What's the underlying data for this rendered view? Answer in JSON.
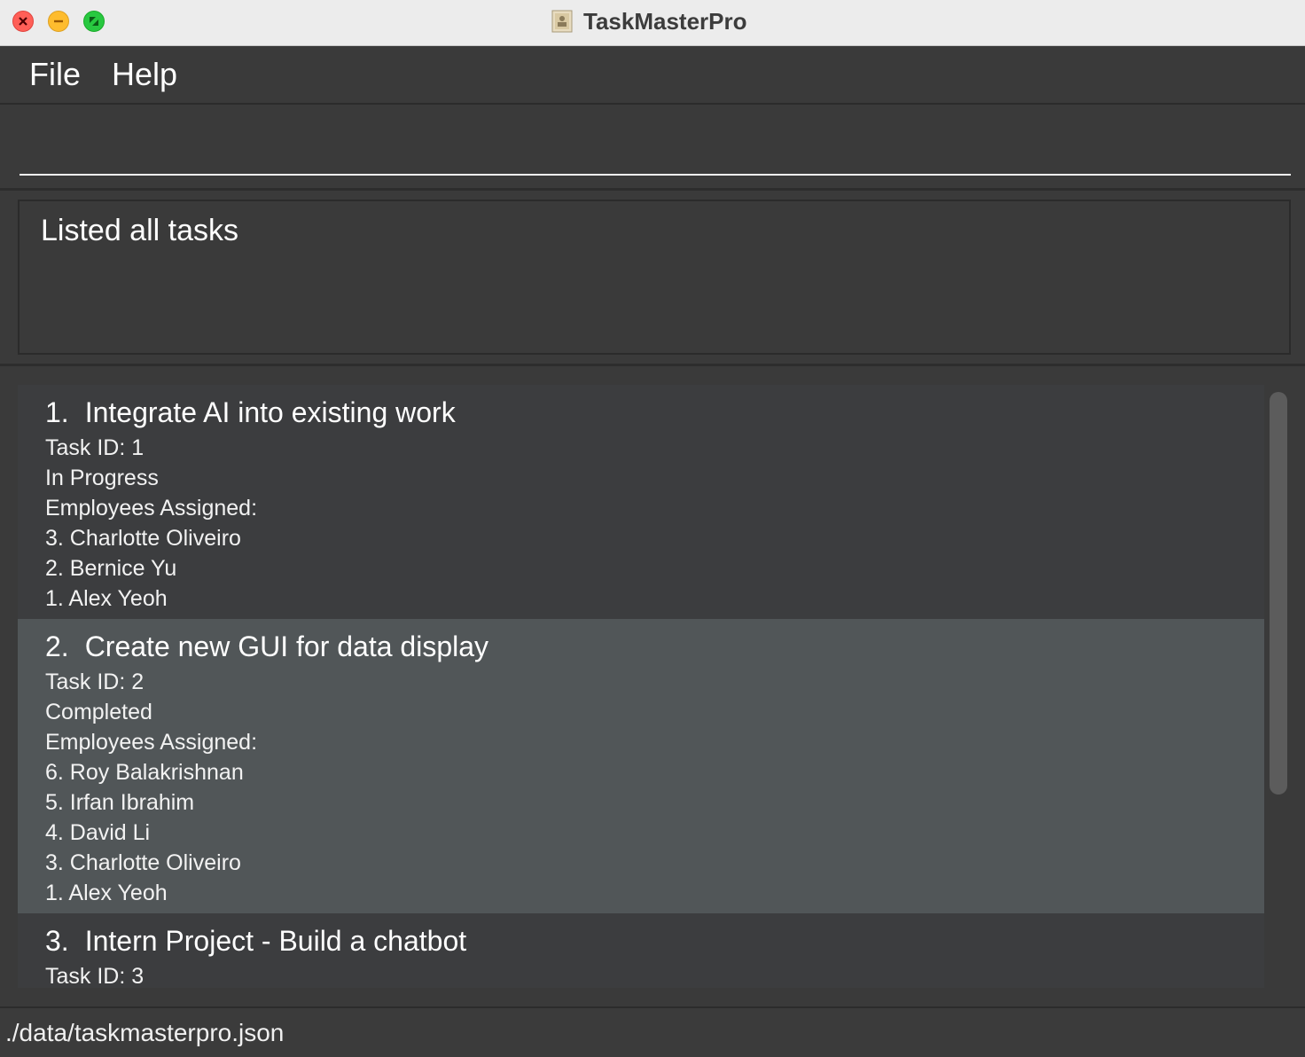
{
  "window": {
    "title": "TaskMasterPro"
  },
  "menu": {
    "file_label": "File",
    "help_label": "Help"
  },
  "command": {
    "value": "",
    "placeholder": ""
  },
  "result": {
    "message": "Listed all tasks"
  },
  "tasks": [
    {
      "index": "1.",
      "title": "Integrate AI into existing work",
      "task_id": "Task ID: 1",
      "status": "In Progress",
      "employees_label": "Employees Assigned:",
      "employees": [
        "3. Charlotte Oliveiro",
        "2. Bernice Yu",
        "1. Alex Yeoh"
      ]
    },
    {
      "index": "2.",
      "title": "Create new GUI for data display",
      "task_id": "Task ID: 2",
      "status": "Completed",
      "employees_label": "Employees Assigned:",
      "employees": [
        "6. Roy Balakrishnan",
        "5. Irfan Ibrahim",
        "4. David Li",
        "3. Charlotte Oliveiro",
        "1. Alex Yeoh"
      ]
    },
    {
      "index": "3.",
      "title": "Intern Project - Build a chatbot",
      "task_id": "Task ID: 3",
      "status": "",
      "employees_label": "",
      "employees": []
    }
  ],
  "status_bar": {
    "file_path": "./data/taskmasterpro.json"
  },
  "colors": {
    "background": "#3a3a3a",
    "card_odd": "#3c3d3f",
    "card_selected": "#515658",
    "close": "#ff5f57",
    "minimize": "#febc2e",
    "maximize": "#28c840"
  },
  "icons": {
    "close": "close-icon",
    "minimize": "minimize-icon",
    "maximize": "fullscreen-icon",
    "app": "app-document-icon"
  }
}
